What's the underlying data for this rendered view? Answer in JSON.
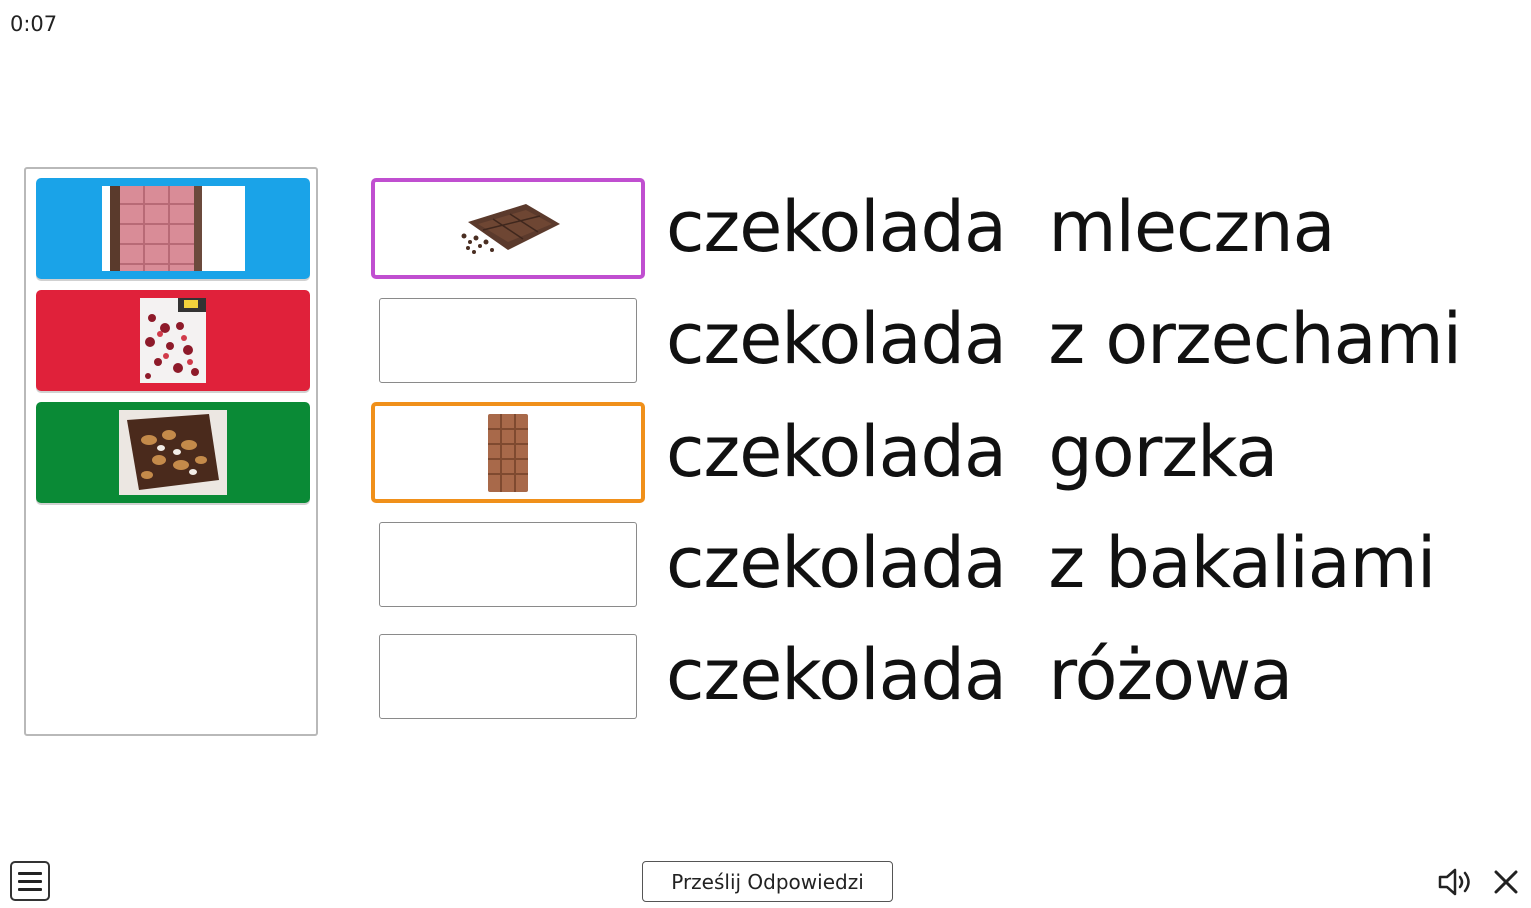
{
  "timer": "0:07",
  "bank": {
    "tiles": [
      {
        "color": "#1aa3e8",
        "image": "pink-chocolate-bar-image"
      },
      {
        "color": "#e0213a",
        "image": "fruit-chocolate-image"
      },
      {
        "color": "#0a8a36",
        "image": "nut-chocolate-image"
      }
    ]
  },
  "rows": [
    {
      "label": "czekolada  mleczna",
      "state": "filled",
      "border_color": "#c04fd0",
      "image": "broken-milk-chocolate-image"
    },
    {
      "label": "czekolada  z orzechami",
      "state": "empty"
    },
    {
      "label": "czekolada  gorzka",
      "state": "filled",
      "border_color": "#f0901a",
      "image": "milk-chocolate-bar-image"
    },
    {
      "label": "czekolada  z bakaliami",
      "state": "empty"
    },
    {
      "label": "czekolada  różowa",
      "state": "empty"
    }
  ],
  "footer": {
    "menu_icon": "menu-icon",
    "submit_label": "Prześlij Odpowiedzi",
    "sound_icon": "speaker-icon",
    "close_icon": "close-icon"
  }
}
